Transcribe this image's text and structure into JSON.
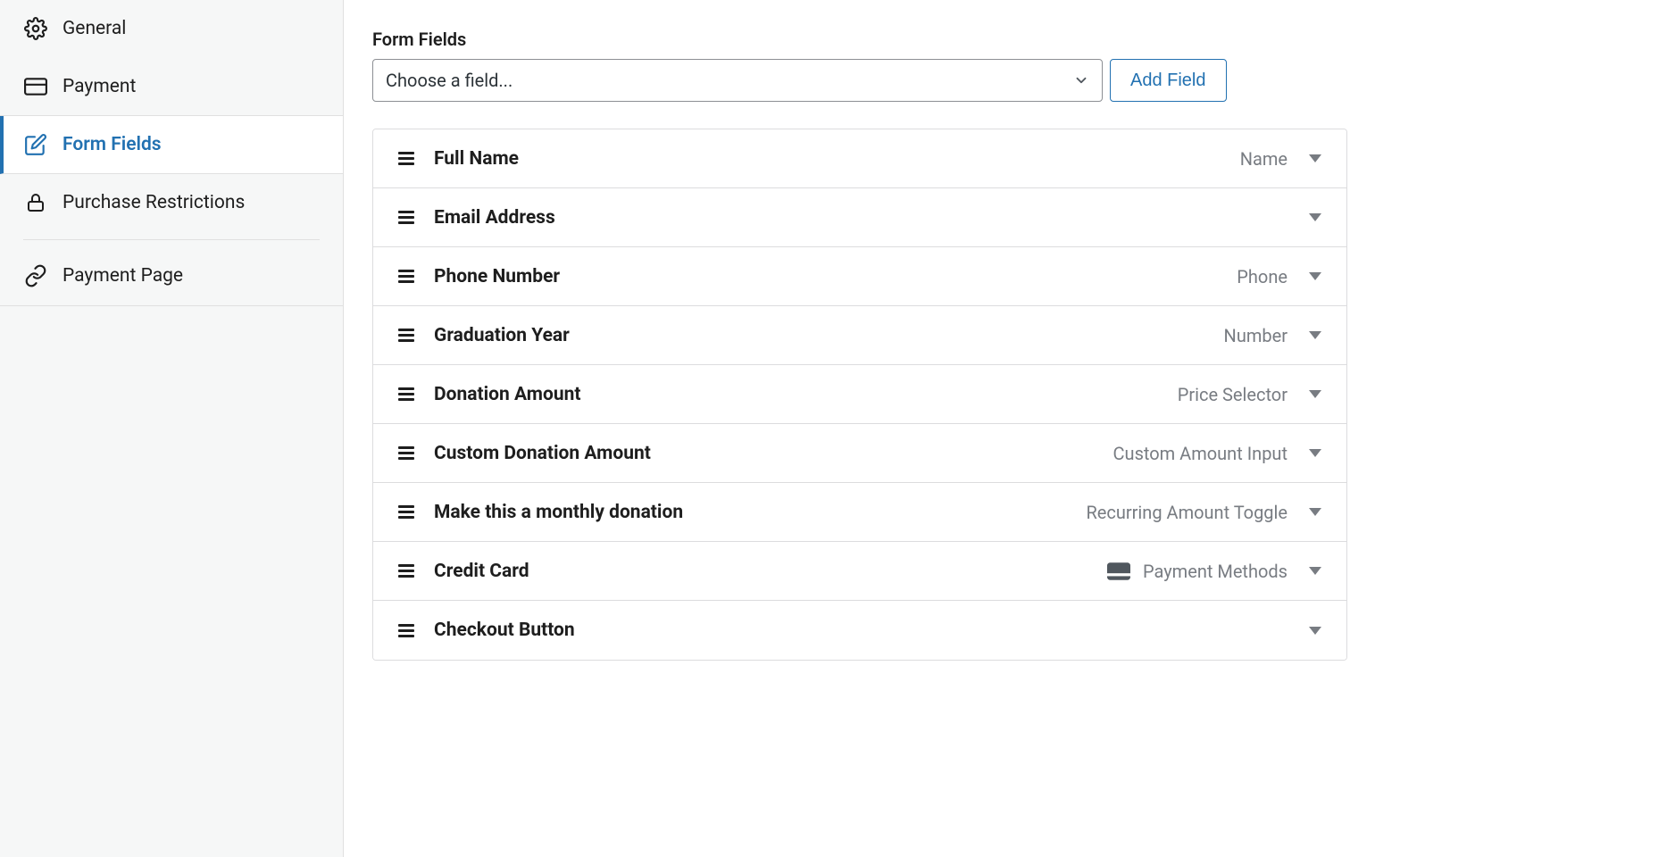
{
  "sidebar": {
    "items": [
      {
        "label": "General"
      },
      {
        "label": "Payment"
      },
      {
        "label": "Form Fields"
      },
      {
        "label": "Purchase Restrictions"
      },
      {
        "label": "Payment Page"
      }
    ]
  },
  "main": {
    "section_label": "Form Fields",
    "select_placeholder": "Choose a field...",
    "add_button": "Add Field",
    "fields": [
      {
        "label": "Full Name",
        "type": "Name"
      },
      {
        "label": "Email Address",
        "type": ""
      },
      {
        "label": "Phone Number",
        "type": "Phone"
      },
      {
        "label": "Graduation Year",
        "type": "Number"
      },
      {
        "label": "Donation Amount",
        "type": "Price Selector"
      },
      {
        "label": "Custom Donation Amount",
        "type": "Custom Amount Input"
      },
      {
        "label": "Make this a monthly donation",
        "type": "Recurring Amount Toggle"
      },
      {
        "label": "Credit Card",
        "type": "Payment Methods",
        "icon": "card"
      },
      {
        "label": "Checkout Button",
        "type": ""
      }
    ]
  }
}
